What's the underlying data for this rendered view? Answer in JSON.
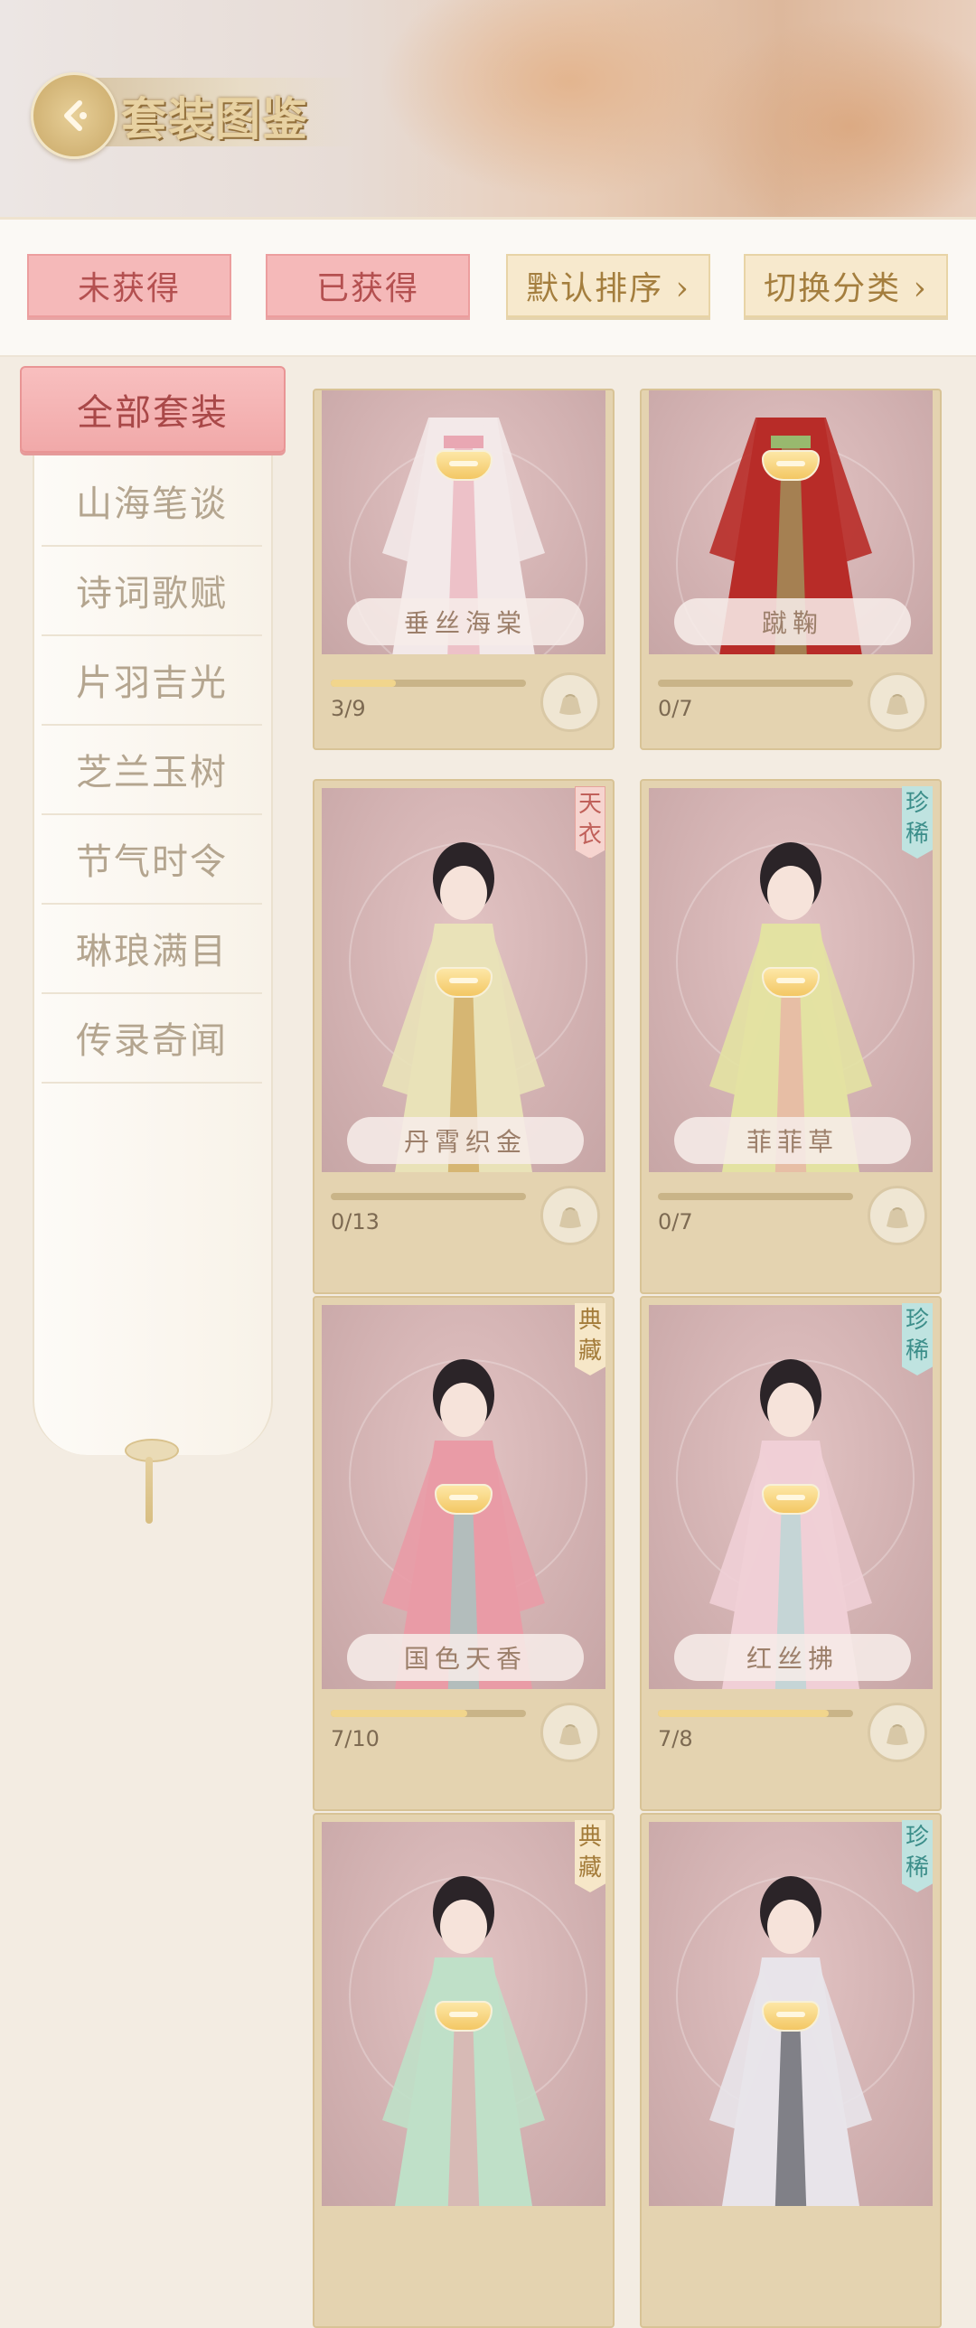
{
  "header": {
    "title": "套装图鉴",
    "back_icon": "back-arrow-icon"
  },
  "filters": {
    "not_obtained": "未获得",
    "obtained": "已获得",
    "sort": "默认排序 ›",
    "switch_category": "切换分类 ›"
  },
  "sidebar": {
    "active": "全部套装",
    "items": [
      "山海笔谈",
      "诗词歌赋",
      "片羽吉光",
      "芝兰玉树",
      "节气时令",
      "琳琅满目",
      "传录奇闻"
    ]
  },
  "colors": {
    "accent_pink": "#f5b9b9",
    "accent_gold": "#e4d3b0",
    "tag_teal": "#bfe3e0",
    "tag_red": "#f6d4cf"
  },
  "cards": [
    {
      "name": "垂丝海棠",
      "progress": "3/9",
      "fraction": 0.333,
      "tag": "",
      "outfit": "#f3e9e9",
      "accent": "#e9a7b3"
    },
    {
      "name": "蹴鞠",
      "progress": "0/7",
      "fraction": 0,
      "tag": "",
      "outfit": "#b82c28",
      "accent": "#98b96e"
    },
    {
      "name": "丹霄织金",
      "progress": "0/13",
      "fraction": 0,
      "tag": "天衣",
      "tag_style": "red",
      "outfit": "#e9e2b8",
      "accent": "#c99a45"
    },
    {
      "name": "菲菲草",
      "progress": "0/7",
      "fraction": 0,
      "tag": "珍稀",
      "tag_style": "teal",
      "outfit": "#e3e2a2",
      "accent": "#e9a6a6"
    },
    {
      "name": "国色天香",
      "progress": "7/10",
      "fraction": 0.7,
      "tag": "典藏",
      "tag_style": "gold",
      "outfit": "#e99ba6",
      "accent": "#8fd4cc"
    },
    {
      "name": "红丝拂",
      "progress": "7/8",
      "fraction": 0.875,
      "tag": "珍稀",
      "tag_style": "teal",
      "outfit": "#f0cfd6",
      "accent": "#a9d9d6"
    },
    {
      "name": "",
      "progress": "",
      "fraction": 0,
      "tag": "典藏",
      "tag_style": "gold",
      "outfit": "#bfe0c8",
      "accent": "#e7a0a8"
    },
    {
      "name": "",
      "progress": "",
      "fraction": 0,
      "tag": "珍稀",
      "tag_style": "teal",
      "outfit": "#e8e4ea",
      "accent": "#3b3d45"
    }
  ]
}
